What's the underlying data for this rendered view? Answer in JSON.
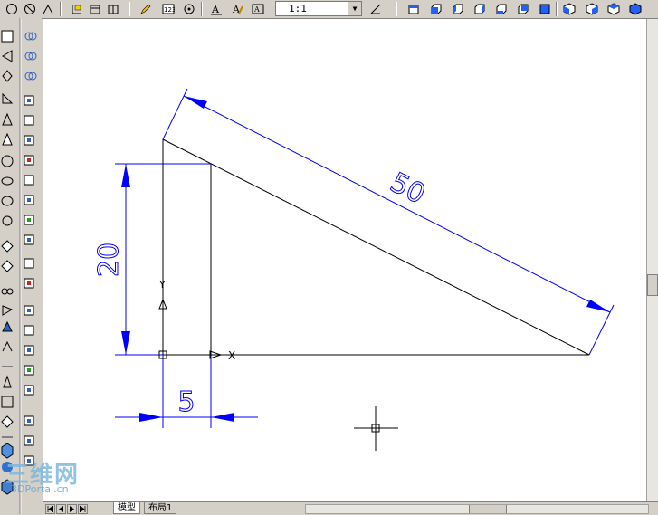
{
  "toolbar": {
    "scale_value": "1:1",
    "icons_left": [
      "circle-icon",
      "circle-slash-icon",
      "arc-icon",
      "dimension-edit-icon",
      "frame-icon",
      "table-icon",
      "pencil-icon",
      "ucs-icon",
      "target-icon",
      "text-a-icon",
      "text-edit-icon",
      "text-style-icon"
    ],
    "icons_right": [
      "view-top-icon",
      "view-front-icon",
      "view-left-icon",
      "view-right-icon",
      "view-bottom-icon",
      "view-back-icon",
      "view-iso-sw-icon",
      "view-iso-se-icon",
      "view-iso-ne-icon",
      "view-iso-nw-icon"
    ]
  },
  "drawing": {
    "dim_hypotenuse": "50",
    "dim_height": "20",
    "dim_offset": "5",
    "ucs_y_label": "Y",
    "ucs_x_label": "X",
    "line_color": "#000000",
    "dimension_color": "#0000ff"
  },
  "tabs": {
    "model": "模型",
    "layout1": "布局1"
  },
  "watermark": {
    "cn": "三维网",
    "en": "3DPortal.cn"
  }
}
